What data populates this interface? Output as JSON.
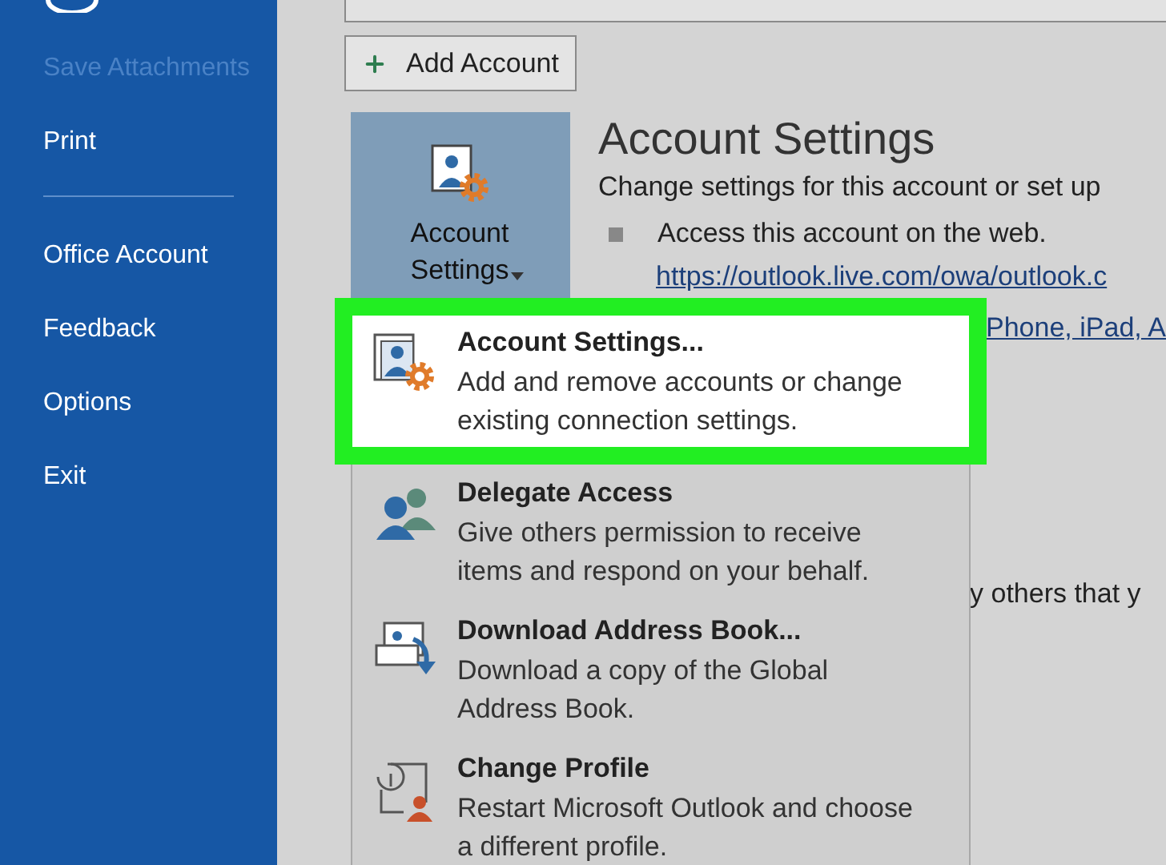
{
  "sidebar": {
    "items": [
      {
        "kind": "item",
        "label": "Save Attachments",
        "disabled": true
      },
      {
        "kind": "item",
        "label": "Print",
        "disabled": false
      },
      {
        "kind": "divider"
      },
      {
        "kind": "item",
        "label": "Office Account",
        "disabled": false
      },
      {
        "kind": "item",
        "label": "Feedback",
        "disabled": false
      },
      {
        "kind": "item",
        "label": "Options",
        "disabled": false
      },
      {
        "kind": "item",
        "label": "Exit",
        "disabled": false
      }
    ]
  },
  "add_account": {
    "label": "Add Account"
  },
  "account_settings_button": {
    "label": "Account Settings",
    "selected": true
  },
  "info": {
    "heading": "Account Settings",
    "description": "Change settings for this account or set up",
    "bullet": "Access this account on the web.",
    "link": "https://outlook.live.com/owa/outlook.c",
    "link_2": "Phone, iPad, A",
    "text_2": "y others that y"
  },
  "menu": {
    "items": [
      {
        "kind": "account-settings",
        "title": "Account Settings...",
        "description": "Add and remove accounts or change existing connection settings.",
        "selected": true
      },
      {
        "kind": "delegate",
        "title": "Delegate Access",
        "description": "Give others permission to receive items and respond on your behalf.",
        "selected": false
      },
      {
        "kind": "address-book",
        "title": "Download Address Book...",
        "description": "Download a copy of the Global Address Book.",
        "selected": false
      },
      {
        "kind": "profile",
        "title": "Change Profile",
        "description": "Restart Microsoft Outlook and choose a different profile.",
        "selected": false
      }
    ]
  }
}
